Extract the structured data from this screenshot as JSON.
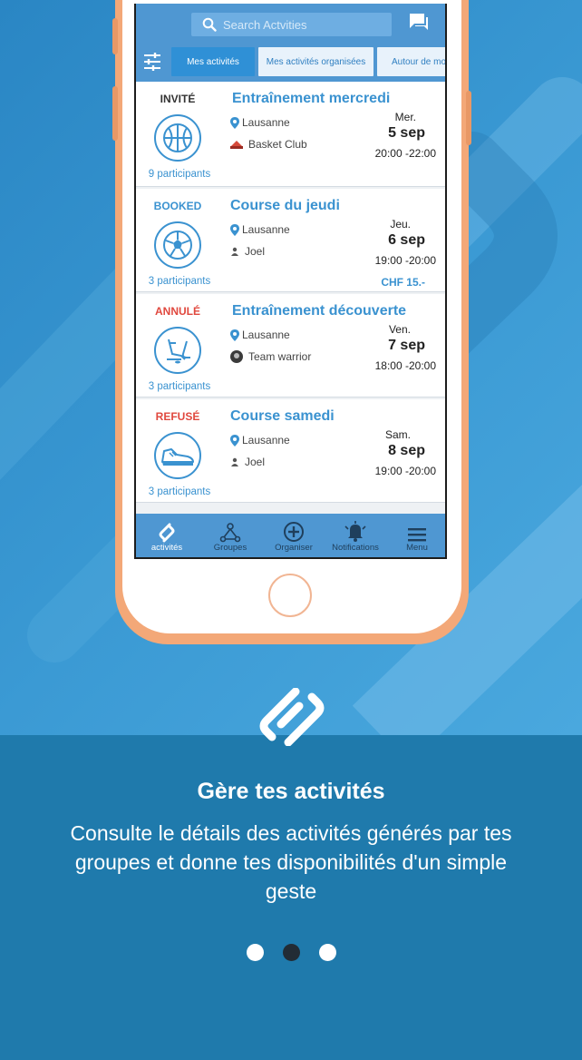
{
  "search": {
    "placeholder": "Search Actvities"
  },
  "tabs": [
    {
      "label": "Mes activités",
      "active": true
    },
    {
      "label": "Mes activités organisées",
      "active": false
    },
    {
      "label": "Autour de moi",
      "active": false
    }
  ],
  "activities": [
    {
      "status": "INVITÉ",
      "status_color": "#333333",
      "icon": "basketball-icon",
      "title": "Entraînement mercredi",
      "location": "Lausanne",
      "organizer": "Basket Club",
      "organizer_icon": "club-logo-icon",
      "day": "Mer.",
      "date": "5 sep",
      "time": "20:00 -22:00",
      "participants": "9 participants",
      "price": ""
    },
    {
      "status": "BOOKED",
      "status_color": "#3a92d0",
      "icon": "soccer-ball-icon",
      "title": "Course du jeudi",
      "location": "Lausanne",
      "organizer": "Joel",
      "organizer_icon": "person-icon",
      "day": "Jeu.",
      "date": "6 sep",
      "time": "19:00 -20:00",
      "participants": "3 participants",
      "price": "CHF 15.-"
    },
    {
      "status": "ANNULÉ",
      "status_color": "#e0483e",
      "icon": "hockey-icon",
      "title": "Entraînement découverte",
      "location": "Lausanne",
      "organizer": "Team warrior",
      "organizer_icon": "team-avatar-icon",
      "day": "Ven.",
      "date": "7 sep",
      "time": "18:00 -20:00",
      "participants": "3 participants",
      "price": ""
    },
    {
      "status": "REFUSÉ",
      "status_color": "#e0483e",
      "icon": "running-shoe-icon",
      "title": "Course samedi",
      "location": "Lausanne",
      "organizer": "Joel",
      "organizer_icon": "person-icon",
      "day": "Sam.",
      "date": "8 sep",
      "time": "19:00 -20:00",
      "participants": "3 participants",
      "price": ""
    }
  ],
  "nav": [
    {
      "label": "activités",
      "icon": "activities-logo-icon",
      "active": true
    },
    {
      "label": "Groupes",
      "icon": "groups-icon",
      "active": false
    },
    {
      "label": "Organiser",
      "icon": "plus-circle-icon",
      "active": false
    },
    {
      "label": "Notifications",
      "icon": "bell-icon",
      "active": false
    },
    {
      "label": "Menu",
      "icon": "hamburger-icon",
      "active": false
    }
  ],
  "onboarding": {
    "headline": "Gère tes activités",
    "subtitle": "Consulte le détails des activités générés par tes groupes et donne tes disponibilités d'un simple geste",
    "pages": 3,
    "current_page": 2
  },
  "colors": {
    "primary": "#4f97d2",
    "accent": "#3a92d0",
    "phone_frame": "#f3a878",
    "footer": "#1f7aac",
    "danger": "#e0483e"
  }
}
